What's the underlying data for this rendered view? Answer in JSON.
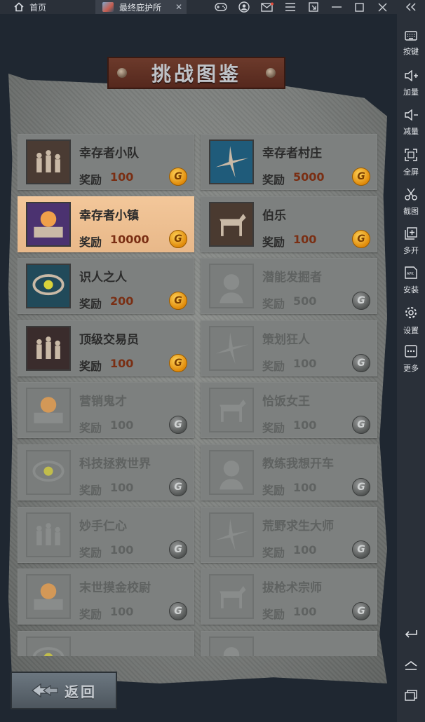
{
  "window": {
    "home_tab": "首页",
    "game_tab": "最终庇护所",
    "close_glyph": "✕",
    "collapse_glyph": "≪"
  },
  "sidebar": {
    "items": [
      {
        "label": "按键",
        "icon": "keyboard-icon"
      },
      {
        "label": "加量",
        "icon": "volume-up-icon"
      },
      {
        "label": "减量",
        "icon": "volume-down-icon"
      },
      {
        "label": "全屏",
        "icon": "fullscreen-icon"
      },
      {
        "label": "截图",
        "icon": "scissors-icon"
      },
      {
        "label": "多开",
        "icon": "multi-instance-icon"
      },
      {
        "label": "安装",
        "icon": "apk-install-icon"
      },
      {
        "label": "设置",
        "icon": "settings-gear-icon"
      },
      {
        "label": "更多",
        "icon": "more-icon"
      }
    ]
  },
  "panel": {
    "title": "挑战图鉴",
    "reward_label": "奖励",
    "coin_glyph": "G",
    "back_label": "返回"
  },
  "challenges": [
    {
      "name": "幸存者小队",
      "reward": "100",
      "state": "unlocked"
    },
    {
      "name": "幸存者村庄",
      "reward": "5000",
      "state": "unlocked"
    },
    {
      "name": "幸存者小镇",
      "reward": "10000",
      "state": "highlighted"
    },
    {
      "name": "伯乐",
      "reward": "100",
      "state": "unlocked"
    },
    {
      "name": "识人之人",
      "reward": "200",
      "state": "unlocked"
    },
    {
      "name": "潜能发掘者",
      "reward": "500",
      "state": "locked"
    },
    {
      "name": "顶级交易员",
      "reward": "100",
      "state": "unlocked"
    },
    {
      "name": "策划狂人",
      "reward": "100",
      "state": "locked"
    },
    {
      "name": "营销鬼才",
      "reward": "100",
      "state": "locked"
    },
    {
      "name": "恰饭女王",
      "reward": "100",
      "state": "locked"
    },
    {
      "name": "科技拯救世界",
      "reward": "100",
      "state": "locked"
    },
    {
      "name": "教练我想开车",
      "reward": "100",
      "state": "locked"
    },
    {
      "name": "妙手仁心",
      "reward": "100",
      "state": "locked"
    },
    {
      "name": "荒野求生大师",
      "reward": "100",
      "state": "locked"
    },
    {
      "name": "末世摸金校尉",
      "reward": "100",
      "state": "locked"
    },
    {
      "name": "拔枪术宗师",
      "reward": "100",
      "state": "locked"
    },
    {
      "name": "",
      "reward": "",
      "state": "locked"
    },
    {
      "name": "",
      "reward": "",
      "state": "locked"
    }
  ],
  "colors": {
    "highlight": "#f0c393",
    "reward_value": "#7a2f14",
    "banner": "#6c3a2b"
  }
}
